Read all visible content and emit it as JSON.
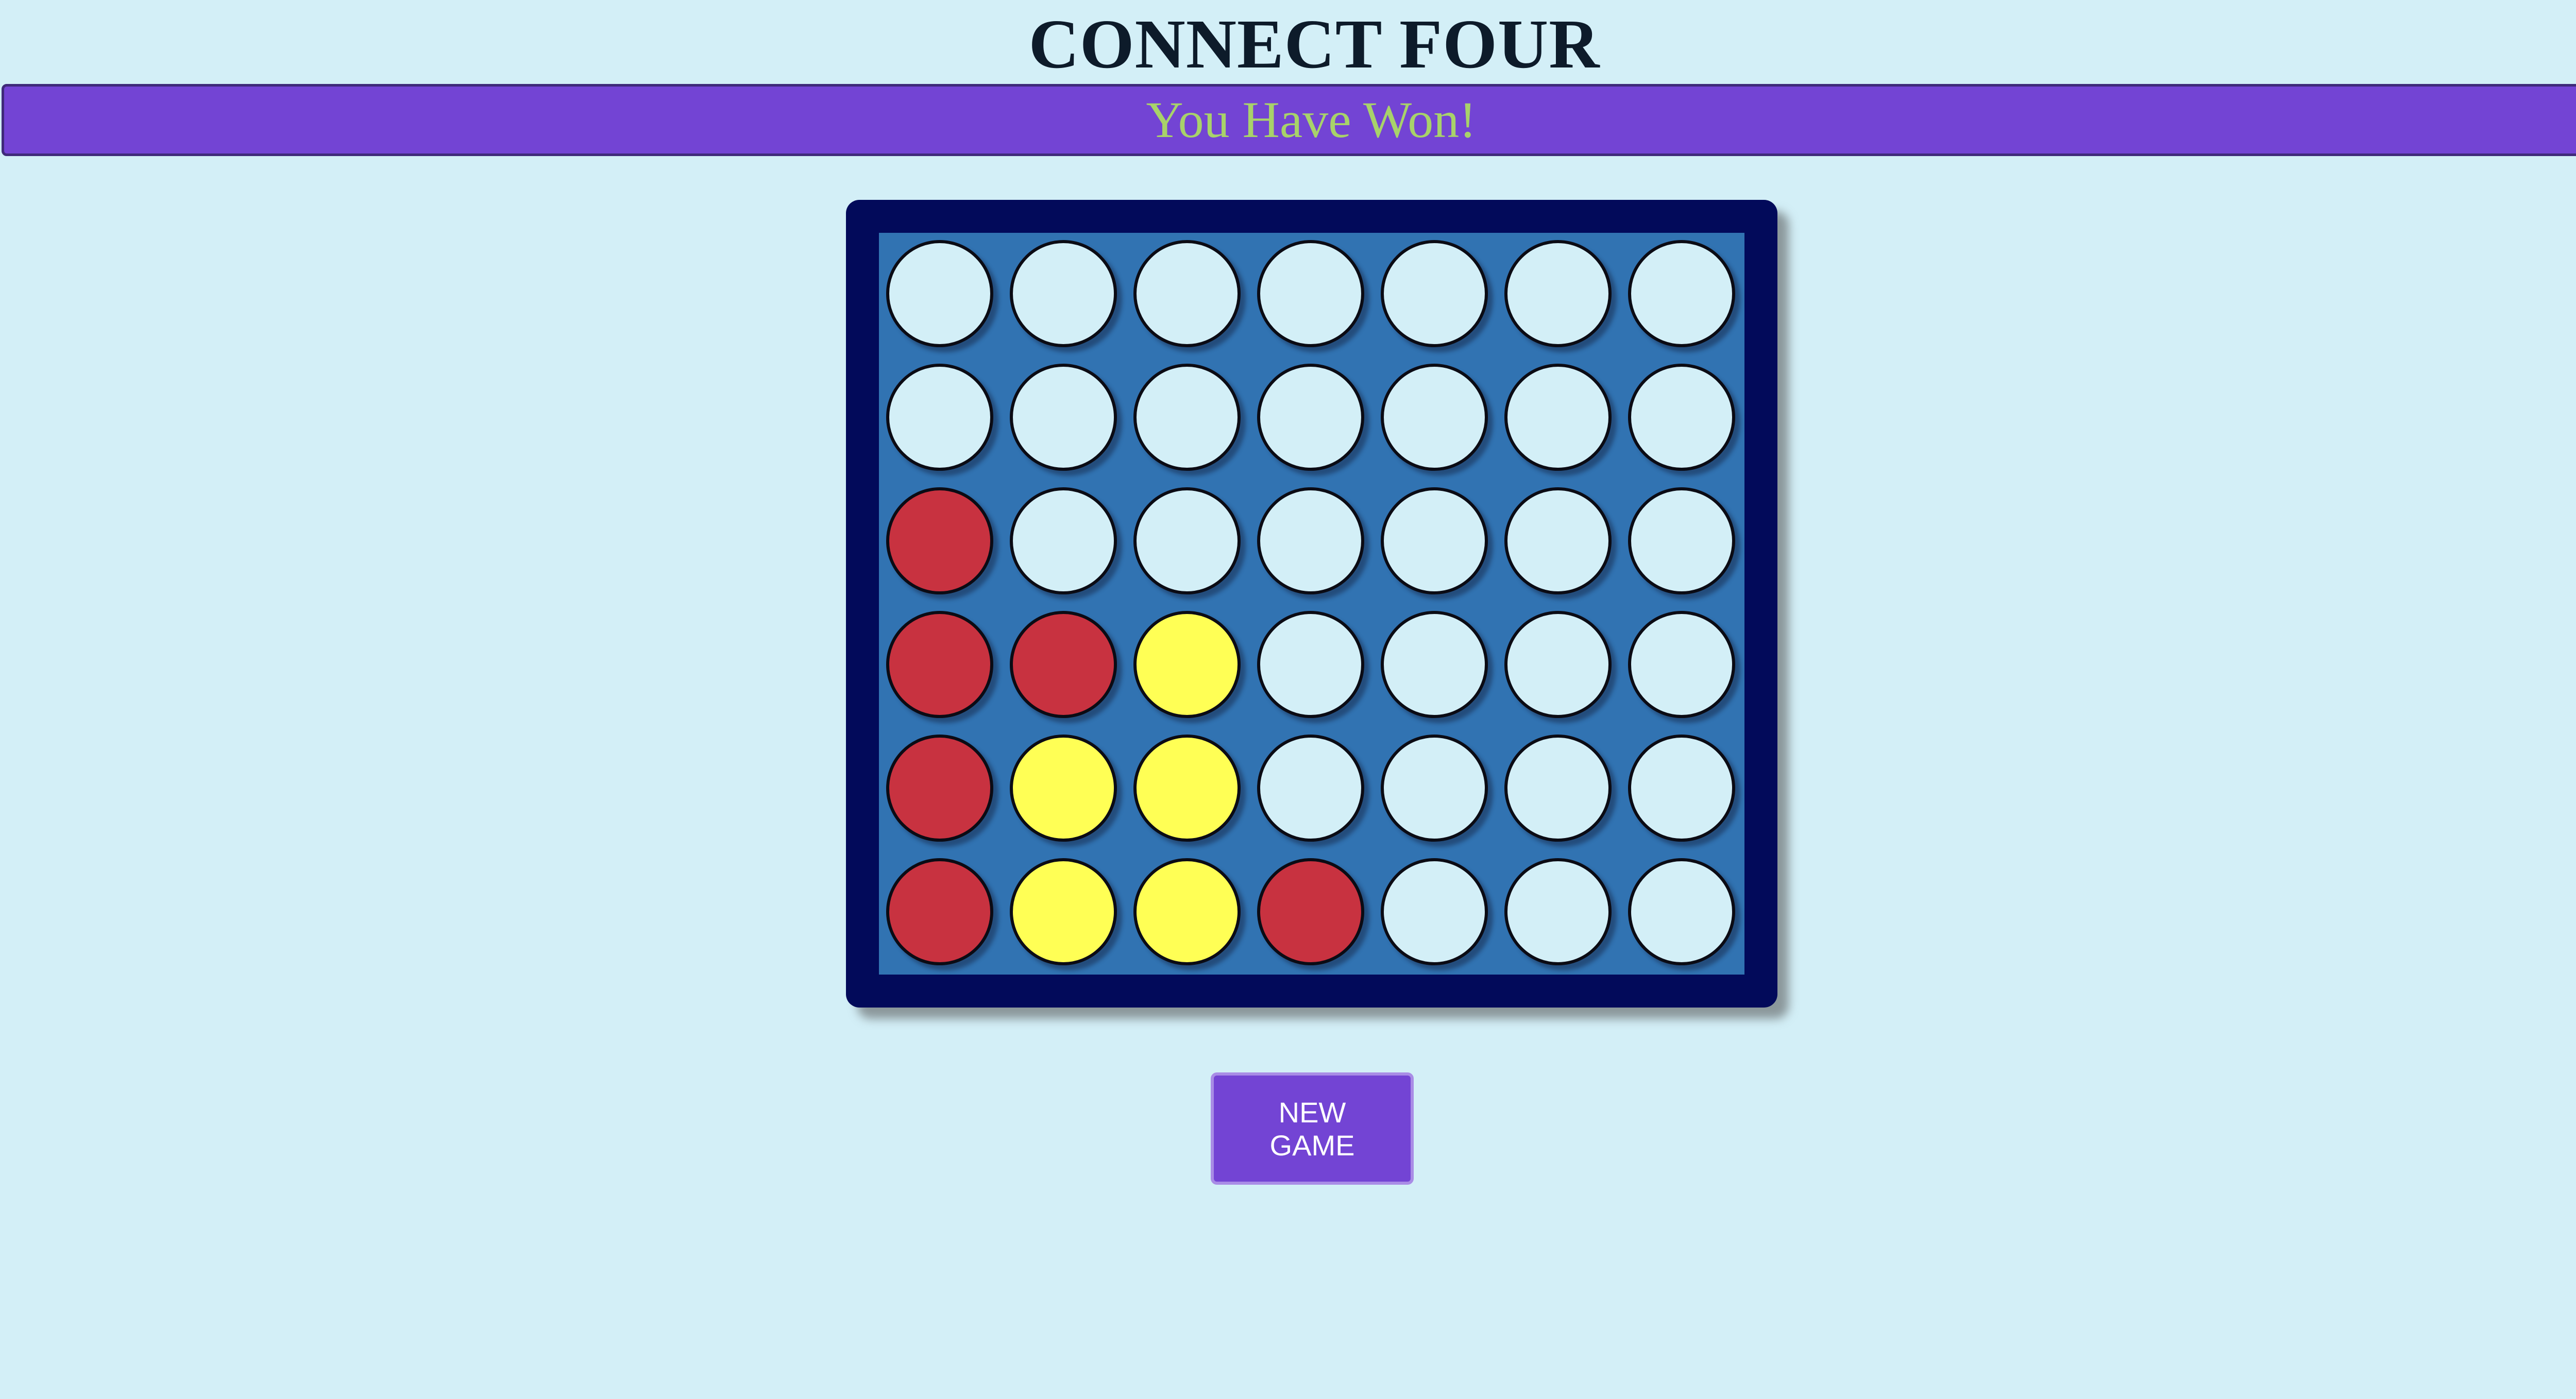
{
  "header": {
    "title": "CONNECT FOUR"
  },
  "status": {
    "message": "You Have Won!"
  },
  "board": {
    "rows": 6,
    "columns": 7,
    "cells": [
      [
        "empty",
        "empty",
        "empty",
        "empty",
        "empty",
        "empty",
        "empty"
      ],
      [
        "empty",
        "empty",
        "empty",
        "empty",
        "empty",
        "empty",
        "empty"
      ],
      [
        "red",
        "empty",
        "empty",
        "empty",
        "empty",
        "empty",
        "empty"
      ],
      [
        "red",
        "red",
        "yellow",
        "empty",
        "empty",
        "empty",
        "empty"
      ],
      [
        "red",
        "yellow",
        "yellow",
        "empty",
        "empty",
        "empty",
        "empty"
      ],
      [
        "red",
        "yellow",
        "yellow",
        "red",
        "empty",
        "empty",
        "empty"
      ]
    ]
  },
  "controls": {
    "new_game_line1": "NEW",
    "new_game_line2": "GAME"
  },
  "colors": {
    "background": "#d3eff7",
    "status_bar": "#7344d4",
    "status_text": "#a8d26a",
    "board_frame": "#020a5a",
    "board_face": "#3173b2",
    "red_disc": "#c83240",
    "yellow_disc": "#ffff55",
    "empty_slot": "#d3eff7"
  }
}
